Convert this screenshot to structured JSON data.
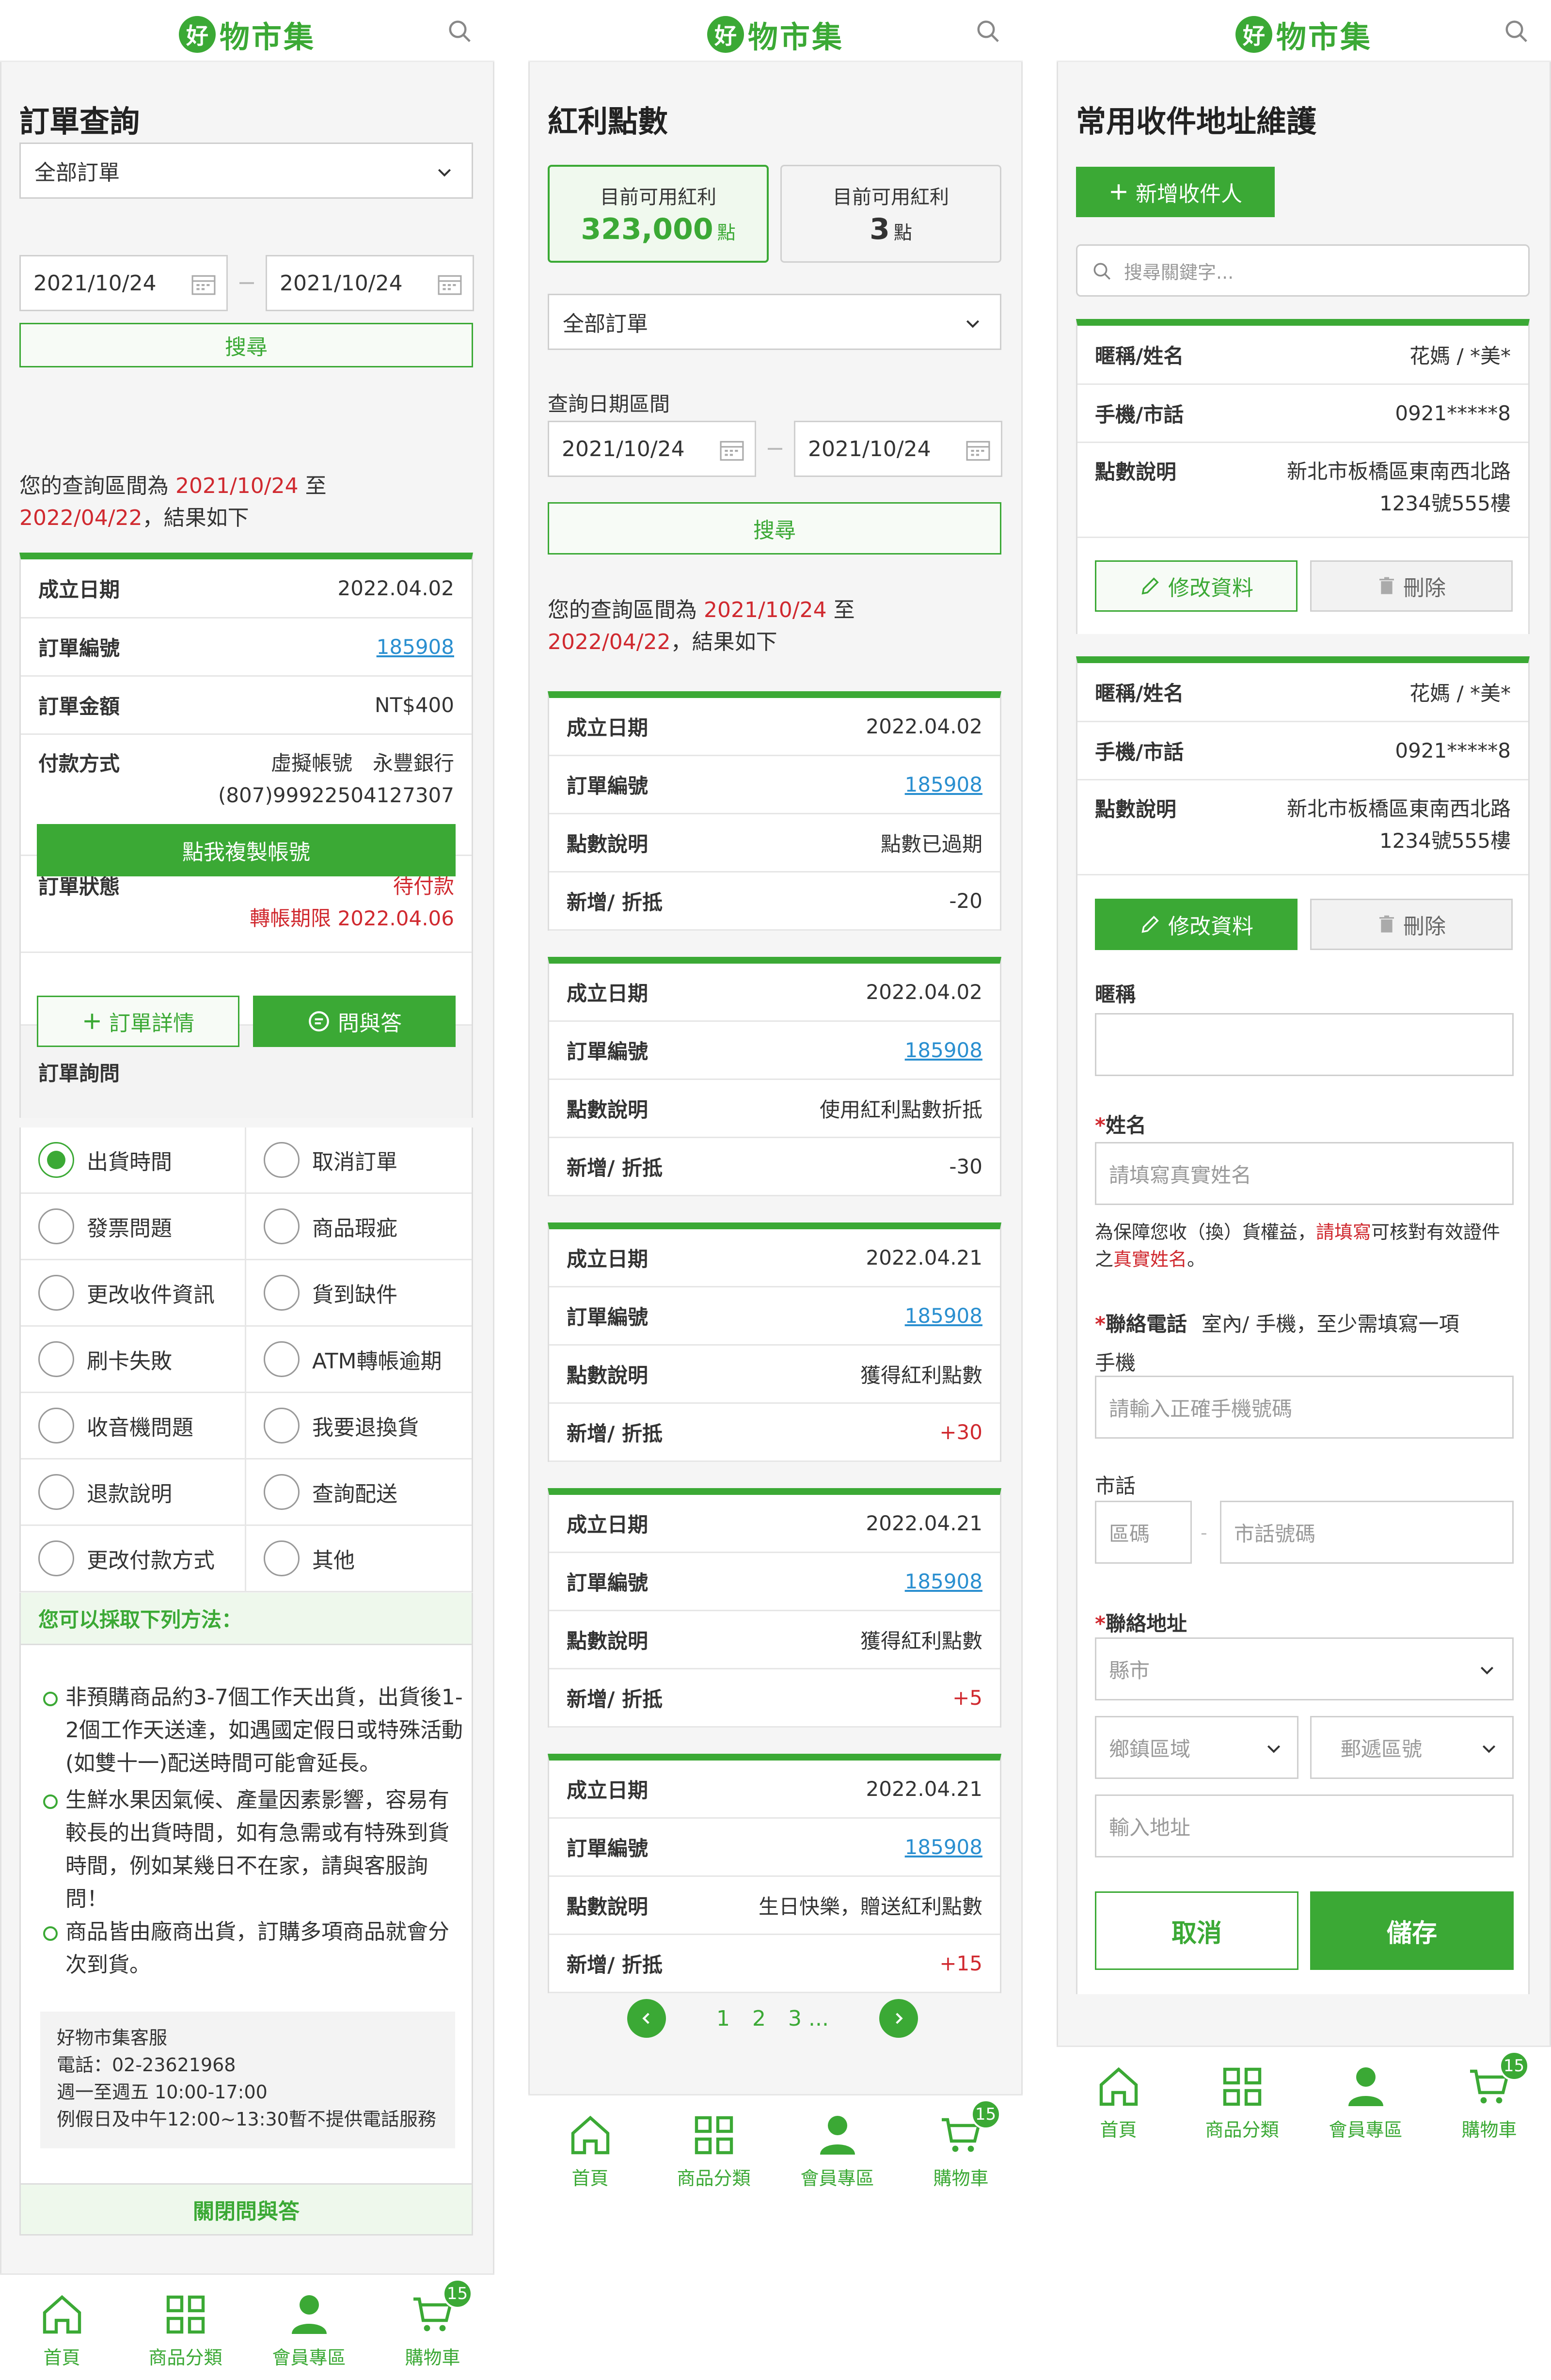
{
  "brand": {
    "logo_mark": "好",
    "name": "物市集"
  },
  "nav": {
    "home": "首頁",
    "category": "商品分類",
    "member": "會員專區",
    "cart": "購物車",
    "cart_count": "15"
  },
  "screen1": {
    "title": "訂單查詢",
    "order_filter": "全部訂單",
    "date_from": "2021/10/24",
    "date_to": "2021/10/24",
    "search_label": "搜尋",
    "query_prefix": "您的查詢區間為 ",
    "query_from": "2021/10/24",
    "query_mid": " 至 ",
    "query_to": "2022/04/22",
    "query_suffix": "，結果如下",
    "order": {
      "date_label": "成立日期",
      "date": "2022.04.02",
      "id_label": "訂單編號",
      "id": "185908",
      "amount_label": "訂單金額",
      "amount": "NT$400",
      "pay_label": "付款方式",
      "pay_line1": "虛擬帳號　永豐銀行",
      "pay_line2": "(807)99922504127307",
      "copy_label": "點我複製帳號",
      "status_label": "訂單狀態",
      "status": "待付款",
      "deadline": "轉帳期限 2022.04.06",
      "detail_label": "訂單詳情",
      "qa_label": "問與答"
    },
    "inquiry_title": "訂單詢問",
    "options": [
      "出貨時間",
      "取消訂單",
      "發票問題",
      "商品瑕疵",
      "更改收件資訊",
      "貨到缺件",
      "刷卡失敗",
      "ATM轉帳逾期",
      "收音機問題",
      "我要退換貨",
      "退款說明",
      "查詢配送",
      "更改付款方式",
      "其他"
    ],
    "tips_title": "您可以採取下列方法：",
    "tips": [
      "非預購商品約3-7個工作天出貨，出貨後1-2個工作天送達，如遇國定假日或特殊活動(如雙十一)配送時間可能會延長。",
      "生鮮水果因氣候、產量因素影響，容易有較長的出貨時間，如有急需或有特殊到貨時間，例如某幾日不在家，請與客服詢問！",
      "商品皆由廠商出貨，訂購多項商品就會分次到貨。"
    ],
    "service": [
      "好物市集客服",
      "電話：02-23621968",
      "週一至週五 10:00-17:00",
      "例假日及中午12:00~13:30暫不提供電話服務"
    ],
    "close_qa": "關閉問與答"
  },
  "screen2": {
    "title": "紅利點數",
    "avail_label": "目前可用紅利",
    "avail_value": "323,000",
    "unit": "點",
    "avail_label2": "目前可用紅利",
    "avail_value2": "3",
    "order_filter": "全部訂單",
    "range_label": "查詢日期區間",
    "date_from": "2021/10/24",
    "date_to": "2021/10/24",
    "search_label": "搜尋",
    "query_prefix": "您的查詢區間為 ",
    "query_from": "2021/10/24",
    "query_mid": " 至 ",
    "query_to": "2022/04/22",
    "query_suffix": "，結果如下",
    "labels": {
      "date": "成立日期",
      "id": "訂單編號",
      "desc": "點數說明",
      "delta": "新增/ 折抵"
    },
    "records": [
      {
        "date": "2022.04.02",
        "id": "185908",
        "desc": "點數已過期",
        "delta": "-20"
      },
      {
        "date": "2022.04.02",
        "id": "185908",
        "desc": "使用紅利點數折抵",
        "delta": "-30"
      },
      {
        "date": "2022.04.21",
        "id": "185908",
        "desc": "獲得紅利點數",
        "delta": "+30"
      },
      {
        "date": "2022.04.21",
        "id": "185908",
        "desc": "獲得紅利點數",
        "delta": "+5"
      },
      {
        "date": "2022.04.21",
        "id": "185908",
        "desc": "生日快樂，贈送紅利點數",
        "delta": "+15"
      }
    ],
    "pages": [
      "1",
      "2",
      "3 ..."
    ]
  },
  "screen3": {
    "title": "常用收件地址維護",
    "add_label": "新增收件人",
    "search_placeholder": "搜尋關鍵字...",
    "labels": {
      "name": "暱稱/姓名",
      "phone": "手機/市話",
      "addr": "點數說明"
    },
    "contacts": [
      {
        "name": "花媽 / *美*",
        "phone": "0921*****8",
        "addr1": "新北市板橋區東南西北路",
        "addr2": "1234號555樓"
      },
      {
        "name": "花媽 / *美*",
        "phone": "0921*****8",
        "addr1": "新北市板橋區東南西北路",
        "addr2": "1234號555樓"
      }
    ],
    "edit_label": "修改資料",
    "delete_label": "刪除",
    "form": {
      "nick_label": "暱稱",
      "name_label": "姓名",
      "name_placeholder": "請填寫真實姓名",
      "hint1": "為保障您收（換）貨權益，",
      "hint_red1": "請填寫",
      "hint2": "可核對有效證件之",
      "hint_red2": "真實姓名",
      "hint3": "。",
      "phone_label": "聯絡電話",
      "phone_note": "室內/ 手機，至少需填寫一項",
      "mobile_label": "手機",
      "mobile_placeholder": "請輸入正確手機號碼",
      "tel_label": "市話",
      "area_placeholder": "區碼",
      "tel_sep": "-",
      "tel_placeholder": "市話號碼",
      "addr_label": "聯絡地址",
      "county": "縣市",
      "district": "鄉鎮區域",
      "zip": "郵遞區號",
      "addr_placeholder": "輸入地址",
      "req": "*"
    },
    "cancel_label": "取消",
    "save_label": "儲存"
  }
}
